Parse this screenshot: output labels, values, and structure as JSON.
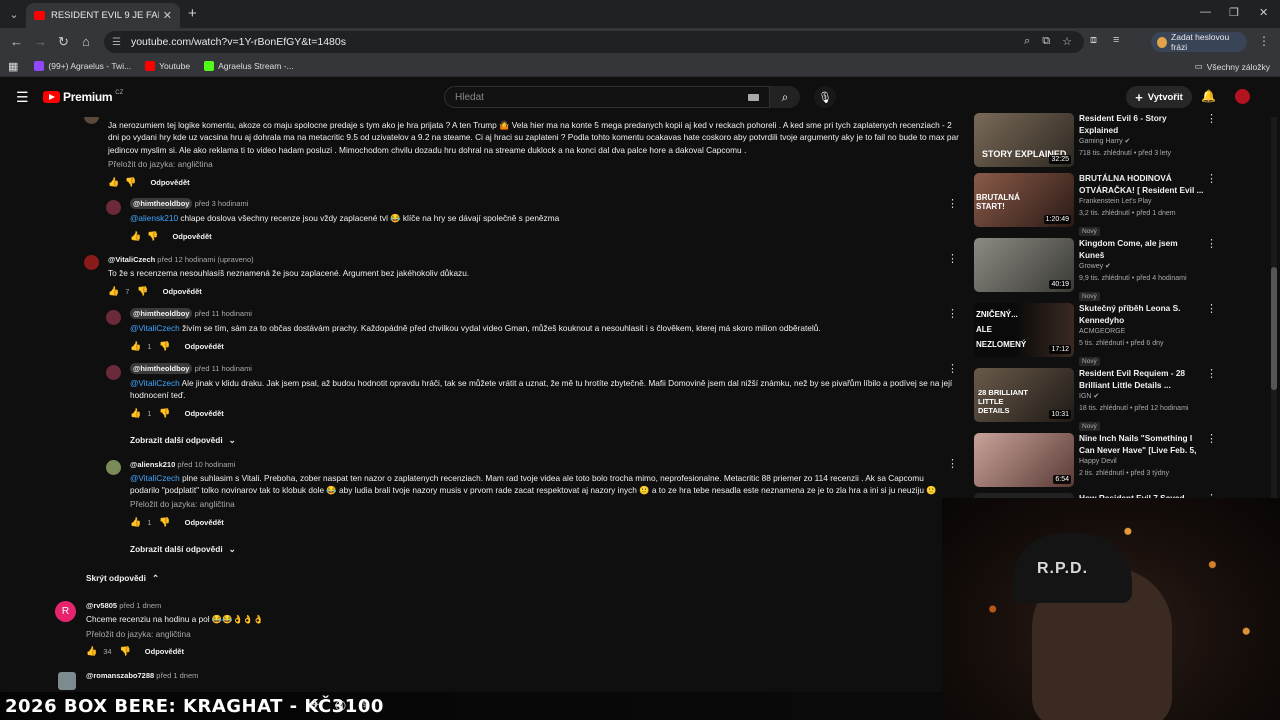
{
  "browser": {
    "tab_title": "RESIDENT EVIL 9 JE FAIL - YouTube",
    "url": "youtube.com/watch?v=1Y-rBonEfGY&t=1480s",
    "password_button": "Zadat heslovou frázi",
    "bookmarks": [
      {
        "label": "(99+) Agraelus - Twi...",
        "color": "#9146ff"
      },
      {
        "label": "Youtube",
        "color": "#ff0000"
      },
      {
        "label": "Agraelus Stream -...",
        "color": "#53fc18"
      }
    ],
    "all_bookmarks": "Všechny záložky"
  },
  "youtube": {
    "logo_text": "Premium",
    "logo_region": "CZ",
    "search_placeholder": "Hledat",
    "create_label": "Vytvořit"
  },
  "comments": {
    "c1": {
      "text": "Ja nerozumiem tej logike komentu, akoze co maju spolocne predaje s tym ako je hra prijata ? A ten  Trump 🤷 Vela hier ma na konte 5 mega predanych kopii aj ked v reckach pohoreli . A ked sme pri tych zaplatenych recenziach - 2 dni po vydani hry kde uz vacsina hru aj dohrala ma na metacritic 9.5 od uzivatelov a 9.2 na steame. Ci aj hraci su zaplateni ?  Podla tohto komentu ocakavas hate coskoro aby potvrdili tvoje argumenty aky je to fail  no bude to max par jedincov myslim si. Ale ako reklama ti to video hadam posluzi . Mimochodom chvilu dozadu hru dohral na streame duklock a na konci dal dva palce hore a dakoval Capcomu .",
      "translate": "Přeložit do jazyka: angličtina",
      "reply": "Odpovědět"
    },
    "c2": {
      "user": "@himtheoldboy",
      "time": "před 3 hodinami",
      "mention": "@aliensk210",
      "text": " chlape doslova všechny recenze jsou vždy zaplacené tvl 😂 klíče na hry se dávají společně s penězma",
      "reply": "Odpovědět"
    },
    "c3": {
      "user": "@VitaliCzech",
      "time": "před 12 hodinami (upraveno)",
      "text": "To že s recenzema nesouhlasíš neznamená že jsou zaplacené. Argument bez jakéhokoliv důkazu.",
      "likes": "7",
      "reply": "Odpovědět"
    },
    "c4": {
      "user": "@himtheoldboy",
      "time": "před 11 hodinami",
      "mention": "@VitaliCzech",
      "text": " živím se tím, sám za to občas dostávám prachy. Každopádně před chvilkou vydal video Gman, můžeš kouknout a nesouhlasit i s člověkem, kterej má skoro milion odběratelů.",
      "likes": "1",
      "reply": "Odpovědět"
    },
    "c5": {
      "user": "@himtheoldboy",
      "time": "před 11 hodinami",
      "mention": "@VitaliCzech",
      "text": " Ale jinak v klidu draku. Jak jsem psal, až budou hodnotit opravdu hráči, tak se můžete vrátit a uznat, že mě tu hrotíte zbytečně. Mafii Domovině jsem dal nižší známku, než by se pivařům líbilo a podívej se na její hodnocení teď.",
      "likes": "1",
      "reply": "Odpovědět"
    },
    "more_replies_1": "Zobrazit další odpovědi",
    "c6": {
      "user": "@aliensk210",
      "time": "před 10 hodinami",
      "mention": "@VitaliCzech",
      "text": " plne suhlasim s Vitali. Preboha, zober naspat ten nazor o zaplatenych recenziach. Mam rad tvoje videa ale toto bolo trocha mimo, neprofesionalne. Metacritic 88 priemer zo 114 recenzii . Ak sa Capcomu podarilo \"podplatit\" tolko novinarov tak to klobuk dole 😂 aby ludia brali tvoje nazory musis v prvom rade zacat respektovat aj nazory inych 🙂 a to ze hra tebe nesadla este neznamena ze je to zla hra a ini si ju neuziju 🙂",
      "translate": "Přeložit do jazyka: angličtina",
      "likes": "1",
      "reply": "Odpovědět"
    },
    "more_replies_2": "Zobrazit další odpovědi",
    "hide_replies": "Skrýt odpovědi",
    "c7": {
      "avatar_letter": "R",
      "user": "@rv5805",
      "time": "před 1 dnem",
      "text": "Chceme recenziu na hodinu a pol 😂😂👌👌👌",
      "translate": "Přeložit do jazyka: angličtina",
      "likes": "34",
      "reply": "Odpovědět"
    },
    "c8": {
      "user": "@romanszabo7288",
      "time": "před 1 dnem"
    }
  },
  "sidebar": [
    {
      "title": "Resident Evil 6 - Story Explained",
      "channel": "Gaming Harry ✔",
      "meta": "718 tis. zhlédnutí • před 3 lety",
      "duration": "32:25",
      "overlay": "STORY EXPLAINED",
      "color": "#4a4640",
      "badge": ""
    },
    {
      "title": "BRUTÁLNA HODINOVÁ OTVÁRAČKA! [ Resident Evil ...",
      "channel": "Frankenstein Let's Play",
      "meta": "3,2 tis. zhlédnutí • před 1 dnem",
      "duration": "1:20:49",
      "overlay": "BRUTALNÁ START!",
      "color": "#6a3b30",
      "badge": "Nový"
    },
    {
      "title": "Kingdom Come, ale jsem Kuneš",
      "channel": "Growey ✔",
      "meta": "9,9 tis. zhlédnutí • před 4 hodinami",
      "duration": "40:19",
      "overlay": "",
      "color": "#5a5a55",
      "badge": "Nový"
    },
    {
      "title": "Skutečný příběh Leona S. Kennedyho",
      "channel": "ACMGEORGE",
      "meta": "5 tis. zhlédnutí • před 6 dny",
      "duration": "17:12",
      "overlay": "ZNIČENÝ... ALE NEZLOMENÝ",
      "color": "#111111",
      "badge": "Nový"
    },
    {
      "title": "Resident Evil Requiem - 28 Brilliant Little Details ...",
      "channel": "IGN ✔",
      "meta": "18 tis. zhlédnutí • před 12 hodinami",
      "duration": "10:31",
      "overlay": "28 BRILLIANT LITTLE DETAILS",
      "color": "#3a3430",
      "badge": "Nový"
    },
    {
      "title": "Nine Inch Nails \"Something I Can Never Have\" [Live Feb. 5, ...",
      "channel": "Happy Devil",
      "meta": "2 tis. zhlédnutí • před 3 týdny",
      "duration": "6:54",
      "overlay": "",
      "color": "#a08080",
      "badge": ""
    },
    {
      "title": "How Resident Evil 7 Saved",
      "channel": "",
      "meta": "",
      "duration": "",
      "overlay": "",
      "color": "#222222",
      "badge": ""
    }
  ],
  "stream": {
    "ticker": "2026 BOX BERE: KRAGHAT - KČ3100 ",
    "cap_text": "R.P.D."
  }
}
